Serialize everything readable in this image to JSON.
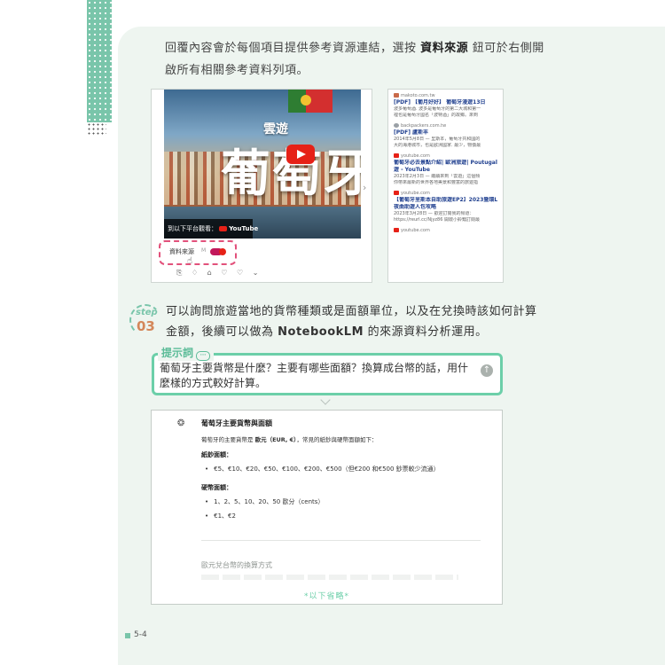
{
  "intro": {
    "before": "回覆內容會於每個項目提供參考資源連結，選按 ",
    "bold": "資料來源",
    "after": " 鈕可於右側開啟所有相關參考資料列項。"
  },
  "video": {
    "small_title": "雲遊",
    "big_title": "葡萄牙",
    "watch_on": "到以下平台觀看：",
    "youtube": "YouTube",
    "sources_chip": "資料來源"
  },
  "sources": [
    {
      "domain": "makoto.com.tw",
      "title": "[PDF] 【葡月好好】 葡萄牙漫遊13日",
      "desc1": "波多葡萄酒. 波多是葡萄牙的第二大城和第一",
      "desc2": "裡也是葡萄牙國名「波特酒」的故鄉。來到"
    },
    {
      "domain": "backpackers.com.tw",
      "title": "[PDF] 盧斯丰",
      "desc1": "2014年5月8日 — 里斯本，葡萄牙共和國的",
      "desc2": "大的海港城市，也是歐洲國家. 最少，物價最"
    },
    {
      "domain": "youtube.com",
      "title": "葡萄牙必去景點介紹| 歐洲旅遊| Poutugal T",
      "title2": "遊 - YouTube",
      "desc1": "2023年2月3日 — 繼續來到「雲遊」這個頻",
      "desc2": "你帶來最新的世界各地美景和豐富的旅遊指"
    },
    {
      "domain": "youtube.com",
      "title": "【葡萄牙里斯本自助旅遊EP2】2023暨環Lis",
      "title2": "夜曲助遊人包攻略",
      "desc1": "2023年3月28日 — 歡迎訂閱我的頻道：",
      "desc2": "https://reurl.cc/Njyz86 開啟小鈴鐺訂閱最"
    },
    {
      "domain": "youtube.com"
    }
  ],
  "step": {
    "word": "step",
    "number": "03",
    "before": "可以詢問旅遊當地的貨幣種類或是面額單位，以及在兌換時該如何計算金額，後續可以做為 ",
    "bold": "NotebookLM",
    "after": " 的來源資料分析運用。"
  },
  "prompt": {
    "label": "提示詞",
    "text": "葡萄牙主要貨幣是什麼？主要有哪些面額？換算成台幣的話，用什麼樣的方式較好計算。"
  },
  "answer": {
    "title": "葡萄牙主要貨幣與面額",
    "intro_before": "葡萄牙的主要貨幣是 ",
    "intro_bold": "歐元（EUR, €）",
    "intro_after": "，常見的紙鈔與硬幣面額如下：",
    "banknotes_heading": "紙鈔面額：",
    "banknotes": "€5、€10、€20、€50、€100、€200、€500（但€200 和€500 鈔票較少流通）",
    "coins_heading": "硬幣面額：",
    "coins": [
      "1、2、5、10、20、50 歐分（cents）",
      "€1、€2"
    ],
    "next_section": "歐元兌台幣的換算方式",
    "omitted": "*以下省略*"
  },
  "footer": {
    "page": "5-4"
  },
  "colors": {
    "accent_green": "#79c5aa",
    "prompt_border": "#6ccfa9",
    "step_orange": "#d4875a",
    "chip_pink": "#e2517b"
  }
}
